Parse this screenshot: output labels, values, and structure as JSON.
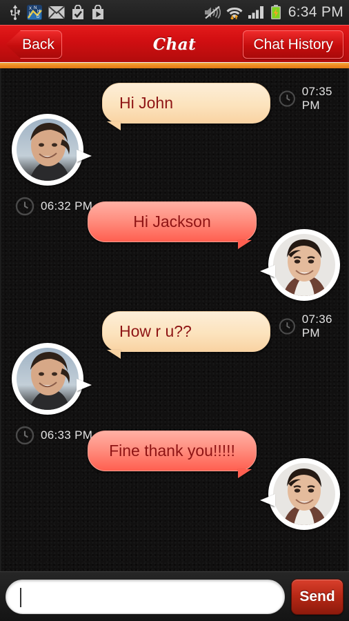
{
  "statusbar": {
    "time": "6:34 PM",
    "left_icons": [
      {
        "name": "usb-icon",
        "glyph": "usb"
      },
      {
        "name": "app-notification-icon",
        "glyph": "xnhd-app"
      },
      {
        "name": "mail-icon",
        "glyph": "envelope"
      },
      {
        "name": "app-installed-icon",
        "glyph": "bag-check"
      },
      {
        "name": "play-store-icon",
        "glyph": "bag-play"
      }
    ],
    "right_icons": [
      {
        "name": "mute-icon",
        "glyph": "speaker-muted"
      },
      {
        "name": "wifi-icon",
        "glyph": "wifi-transfer"
      },
      {
        "name": "signal-icon",
        "glyph": "signal-bars"
      },
      {
        "name": "battery-charging-icon",
        "glyph": "battery-bolt"
      }
    ]
  },
  "header": {
    "back_label": "Back",
    "title": "Chat",
    "history_label": "Chat History",
    "bar_color": "#d30f12",
    "accent_color": "#f08a22"
  },
  "messages": [
    {
      "id": 1,
      "side": "left",
      "text": "Hi John",
      "time": "07:35 PM",
      "sender": "contact",
      "bubble_color": "#fce3bd",
      "text_color": "#8e1414"
    },
    {
      "id": 2,
      "side": "right",
      "text": "Hi Jackson",
      "time": "06:32 PM",
      "sender": "me",
      "bubble_color": "#ff8b7c",
      "text_color": "#8e1414"
    },
    {
      "id": 3,
      "side": "left",
      "text": "How r u??",
      "time": "07:36 PM",
      "sender": "contact",
      "bubble_color": "#fce3bd",
      "text_color": "#8e1414"
    },
    {
      "id": 4,
      "side": "right",
      "text": "Fine thank you!!!!!",
      "time": "06:33 PM",
      "sender": "me",
      "bubble_color": "#ff8b7c",
      "text_color": "#8e1414"
    }
  ],
  "composer": {
    "input_value": "",
    "input_placeholder": "",
    "send_label": "Send",
    "send_color": "#b62816"
  }
}
